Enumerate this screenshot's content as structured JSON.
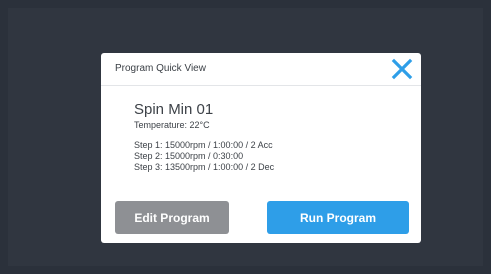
{
  "dialog": {
    "title": "Program Quick View",
    "close_icon": "close-icon",
    "accent_color": "#2e9ee8"
  },
  "program": {
    "name": "Spin Min 01",
    "temperature": "Temperature: 22°C",
    "steps": [
      "Step 1: 15000rpm / 1:00:00 / 2 Acc",
      "Step 2: 15000rpm / 0:30:00",
      "Step 3: 13500rpm / 1:00:00 / 2 Dec"
    ]
  },
  "actions": {
    "edit_label": "Edit Program",
    "run_label": "Run Program"
  }
}
